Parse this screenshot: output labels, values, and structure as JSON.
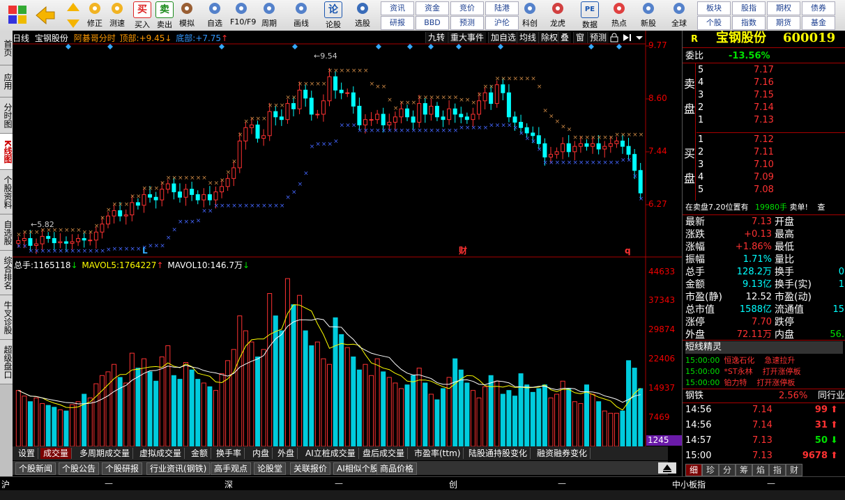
{
  "toolbar": {
    "buttons": [
      {
        "label": "修正",
        "icon": "refresh-icon"
      },
      {
        "label": "测速",
        "icon": "stopwatch-icon"
      },
      {
        "label": "买入",
        "icon": "buy-icon",
        "glyph": "买"
      },
      {
        "label": "卖出",
        "icon": "sell-icon",
        "glyph": "卖"
      },
      {
        "label": "模拟",
        "icon": "gavel-icon"
      },
      {
        "label": "自选",
        "icon": "star-icon"
      },
      {
        "label": "F10/F9",
        "icon": "f10-icon"
      },
      {
        "label": "周期",
        "icon": "clock-icon"
      },
      {
        "label": "画线",
        "icon": "pencil-icon"
      },
      {
        "label": "论股",
        "icon": "discuss-icon",
        "glyph": "论"
      },
      {
        "label": "选股",
        "icon": "select-stock-icon"
      },
      {
        "label": "科创",
        "icon": "kechuang-icon"
      },
      {
        "label": "龙虎",
        "icon": "dragon-tiger-icon"
      },
      {
        "label": "数据",
        "icon": "pe-icon",
        "glyph": "PE"
      },
      {
        "label": "热点",
        "icon": "hot-icon"
      },
      {
        "label": "新股",
        "icon": "new-stock-icon"
      },
      {
        "label": "全球",
        "icon": "globe-icon"
      }
    ],
    "grid": [
      [
        "资讯",
        "资金",
        "竞价",
        "陆港"
      ],
      [
        "研报",
        "BBD",
        "预测",
        "沪伦"
      ]
    ],
    "grid_right": [
      [
        "板块",
        "股指",
        "期权",
        "债券"
      ],
      [
        "个股",
        "指数",
        "期货",
        "基金"
      ]
    ]
  },
  "left_tabs": [
    "首页",
    "应用",
    "分时图",
    "K线图",
    "个股资料",
    "自选股",
    "综合排名",
    "牛叉诊股",
    "超级盘口"
  ],
  "chart": {
    "info": {
      "period": "日线",
      "name": "宝钢股份",
      "indicator": "阿碁哥分时",
      "top_label": "顶部:",
      "top_value": "+9.45",
      "bottom_label": "底部:",
      "bottom_value": "+7.75"
    },
    "func_buttons": [
      "九转",
      "重大事件",
      "加自选",
      "均线",
      "除权",
      "叠",
      "窗",
      "预测"
    ],
    "price_axis": [
      "9.77",
      "8.60",
      "7.44",
      "6.27"
    ],
    "high_label": "9.54",
    "low_label": "5.82",
    "markers": [
      "L",
      "财",
      "q"
    ],
    "vol_info": {
      "total_label": "总手:",
      "total": "1165118",
      "ma5_label": "MAVOL5:",
      "ma5": "1764227",
      "ma10_label": "MAVOL10:",
      "ma10": "146.7万"
    },
    "vol_axis": [
      "44633",
      "37343",
      "29874",
      "22406",
      "14937",
      "7469"
    ],
    "vol_current": "1245"
  },
  "chart_data": {
    "type": "bar",
    "title": "",
    "price_series": {
      "name": "日K",
      "close": [
        6.24,
        6.28,
        6.15,
        6.18,
        6.32,
        6.28,
        6.2,
        6.22,
        6.19,
        6.22,
        6.28,
        6.25,
        6.25,
        6.4,
        6.55,
        6.7,
        6.8,
        6.7,
        6.72,
        6.95,
        6.9,
        7.1,
        7.05,
        7.0,
        7.2,
        7.3,
        7.15,
        7.05,
        7.2,
        7.1,
        7.0,
        7.1,
        7.0,
        7.15,
        7.25,
        7.4,
        7.6,
        8.1,
        8.35,
        8.4,
        8.15,
        8.2,
        8.65,
        8.55,
        8.5,
        8.8,
        8.7,
        9.05,
        8.9,
        8.6,
        8.6,
        8.85,
        9.3,
        9.05,
        9.0,
        9.0,
        8.75,
        8.4,
        8.5,
        8.5,
        8.6,
        8.4,
        8.45,
        8.55,
        8.7,
        8.55,
        8.45,
        8.8,
        8.6,
        8.75,
        8.55,
        8.5,
        8.7,
        8.6,
        8.55,
        8.5,
        8.6,
        8.85,
        9.0,
        8.8,
        9.15,
        9.0,
        8.55,
        8.45,
        8.35,
        8.25,
        8.2,
        8.05,
        7.8,
        7.85,
        7.9,
        8.05,
        7.9,
        8.0,
        8.05,
        8.0,
        8.05,
        7.95,
        8.0,
        8.05,
        8.1,
        8.0,
        7.85,
        7.55,
        7.13
      ]
    },
    "volume_series": {
      "name": "成交量",
      "values": [
        15000,
        13500,
        12000,
        13000,
        11500,
        11000,
        10500,
        9800,
        9500,
        11200,
        12000,
        14000,
        13000,
        16800,
        19000,
        20000,
        22000,
        18500,
        17000,
        25000,
        21000,
        23500,
        20000,
        17500,
        24000,
        27000,
        19000,
        18000,
        22500,
        20500,
        18000,
        17000,
        16000,
        15000,
        19500,
        23000,
        26000,
        35000,
        31000,
        28000,
        24000,
        26000,
        41000,
        35000,
        31000,
        45000,
        38000,
        40500,
        31000,
        27000,
        28000,
        23500,
        22000,
        34500,
        30000,
        26500,
        24000,
        20500,
        22000,
        19000,
        23500,
        20000,
        18500,
        17000,
        15500,
        16500,
        19000,
        21000,
        17000,
        14000,
        12500,
        15500,
        18500,
        23500,
        20500,
        17000,
        15000,
        13000,
        16000,
        19000,
        17500,
        14000,
        15000,
        13500,
        19500,
        16500,
        14500,
        15500,
        16500,
        13000,
        14000,
        17500,
        15500,
        12000,
        11500,
        16500,
        14000,
        12000,
        9500,
        8900,
        8900,
        9500,
        23000,
        21000,
        15500
      ]
    },
    "ylim": [
      6.0,
      9.9
    ],
    "vol_ylim": [
      0,
      48000
    ]
  },
  "bottom_tabs1": [
    "设置",
    "成交量",
    "多周期成交量",
    "虚拟成交量",
    "金额",
    "换手率",
    "内盘",
    "外盘",
    "AI立桩成交量",
    "盘后成交量",
    "市盈率(ttm)",
    "陆股通持股变化",
    "融资融券变化"
  ],
  "bottom_tabs2": [
    "个股新闻",
    "个股公告",
    "个股研报",
    "行业资讯(钢铁)",
    "高手观点",
    "论股堂",
    "关联报价",
    "AI相似个股",
    "商品价格"
  ],
  "status_bar": {
    "sh_label": "沪",
    "sh_value": "—",
    "sz_label": "深",
    "sz_value": "—",
    "cy_label": "创",
    "cy_value": "—",
    "zx_label": "中小板指",
    "zx_value": "—"
  },
  "right_panel": {
    "header": {
      "mark": "R",
      "name": "宝钢股份",
      "code": "600019"
    },
    "weibi": {
      "label": "委比",
      "value": "-13.56%"
    },
    "sell_side_label": [
      "卖",
      "盘"
    ],
    "buy_side_label": [
      "买",
      "盘"
    ],
    "sell": [
      {
        "level": "5",
        "price": "7.17"
      },
      {
        "level": "4",
        "price": "7.16"
      },
      {
        "level": "3",
        "price": "7.15"
      },
      {
        "level": "2",
        "price": "7.14"
      },
      {
        "level": "1",
        "price": "7.13"
      }
    ],
    "buy": [
      {
        "level": "1",
        "price": "7.12"
      },
      {
        "level": "2",
        "price": "7.11"
      },
      {
        "level": "3",
        "price": "7.10"
      },
      {
        "level": "4",
        "price": "7.09"
      },
      {
        "level": "5",
        "price": "7.08"
      }
    ],
    "alert": {
      "text": "在卖盘7.20位置有",
      "qty": "19980手",
      "tag": "卖单!",
      "more": "查"
    },
    "quote_left": [
      {
        "label": "最新",
        "value": "7.13",
        "color": "red"
      },
      {
        "label": "涨跌",
        "value": "+0.13",
        "color": "red"
      },
      {
        "label": "涨幅",
        "value": "+1.86%",
        "color": "red"
      },
      {
        "label": "振幅",
        "value": "1.71%",
        "color": "cyan"
      },
      {
        "label": "总手",
        "value": "128.2万",
        "color": "cyan"
      },
      {
        "label": "金额",
        "value": "9.13亿",
        "color": "cyan"
      },
      {
        "label": "市盈(静)",
        "value": "12.52",
        "color": "white"
      },
      {
        "label": "总市值",
        "value": "1588亿",
        "color": "cyan"
      },
      {
        "label": "涨停",
        "value": "7.70",
        "color": "red"
      },
      {
        "label": "外盘",
        "value": "72.11万",
        "color": "red"
      }
    ],
    "quote_right": [
      "开盘",
      "最高",
      "最低",
      "量比",
      "换手",
      "换手(实)",
      "市盈(动)",
      "流通值",
      "跌停",
      "内盘"
    ],
    "quote_right_vals": [
      "",
      "",
      "",
      "",
      "0",
      "1",
      "",
      "15",
      "",
      "56."
    ],
    "short_title": "短线精灵",
    "short_items": [
      {
        "time": "15:00:00",
        "name": "恒逸石化",
        "event": "急速拉升"
      },
      {
        "time": "15:00:00",
        "name": "*ST永林",
        "event": "打开涨停板"
      },
      {
        "time": "15:00:00",
        "name": "铂力特",
        "event": "打开涨停板"
      }
    ],
    "industry": {
      "name": "钢铁",
      "change": "2.56%",
      "tag": "同行业"
    },
    "ticks": [
      {
        "time": "14:56",
        "price": "7.14",
        "vol": "99",
        "dir": "up"
      },
      {
        "time": "14:56",
        "price": "7.14",
        "vol": "31",
        "dir": "up"
      },
      {
        "time": "14:57",
        "price": "7.13",
        "vol": "50",
        "dir": "down"
      },
      {
        "time": "15:00",
        "price": "7.13",
        "vol": "9678",
        "dir": "up"
      }
    ],
    "tabs": [
      "细",
      "珍",
      "分",
      "筹",
      "焰",
      "指",
      "财"
    ]
  }
}
